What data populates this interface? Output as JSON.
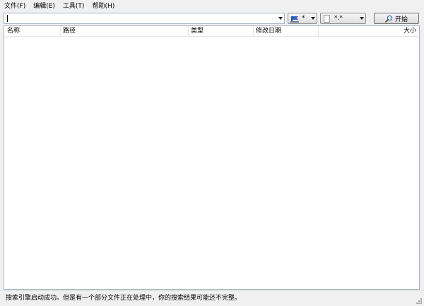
{
  "menu": [
    "文件(F)",
    "编辑(E)",
    "工具(T)",
    "帮助(H)"
  ],
  "search": {
    "value": "",
    "placeholder": ""
  },
  "drive_filter": {
    "selected": "*",
    "icon": "drive-icon"
  },
  "ext_filter": {
    "selected": "*.*",
    "icon": "file-icon"
  },
  "start_button": {
    "label": "开始",
    "icon": "search-icon"
  },
  "columns": {
    "name": "名称",
    "path": "路径",
    "type": "类型",
    "modified": "修改日期",
    "size": "大小"
  },
  "rows": [],
  "status": "搜索引擎启动成功。但是有一个部分文件正在处理中，你的搜索结果可能还不完整。",
  "colors": {
    "window_bg": "#f0f0f0",
    "list_bg": "#ffffff",
    "border": "#a9b3c4"
  }
}
